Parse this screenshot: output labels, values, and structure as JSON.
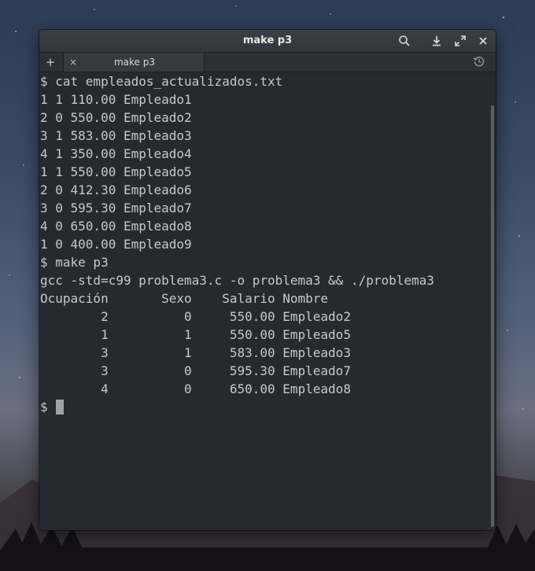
{
  "window": {
    "title": "make p3",
    "buttons": {
      "search_icon": "search-icon",
      "download_icon": "download-icon",
      "maximize_icon": "maximize-icon",
      "close_icon": "close-icon"
    }
  },
  "tabs": {
    "add_label": "+",
    "items": [
      {
        "label": "make p3",
        "close_label": "×"
      }
    ]
  },
  "terminal": {
    "lines": [
      "$ cat empleados_actualizados.txt",
      "1 1 110.00 Empleado1",
      "2 0 550.00 Empleado2",
      "3 1 583.00 Empleado3",
      "4 1 350.00 Empleado4",
      "1 1 550.00 Empleado5",
      "2 0 412.30 Empleado6",
      "3 0 595.30 Empleado7",
      "4 0 650.00 Empleado8",
      "1 0 400.00 Empleado9",
      "$ make p3",
      "gcc -std=c99 problema3.c -o problema3 && ./problema3",
      "Ocupación       Sexo    Salario Nombre",
      "        2          0     550.00 Empleado2",
      "        1          1     550.00 Empleado5",
      "        3          1     583.00 Empleado3",
      "        3          0     595.30 Empleado7",
      "        4          0     650.00 Empleado8"
    ],
    "prompt": "$"
  },
  "colors": {
    "terminal_bg": "#252a30",
    "terminal_fg": "#c7c9cb",
    "titlebar_bg": "#3a3f45"
  }
}
